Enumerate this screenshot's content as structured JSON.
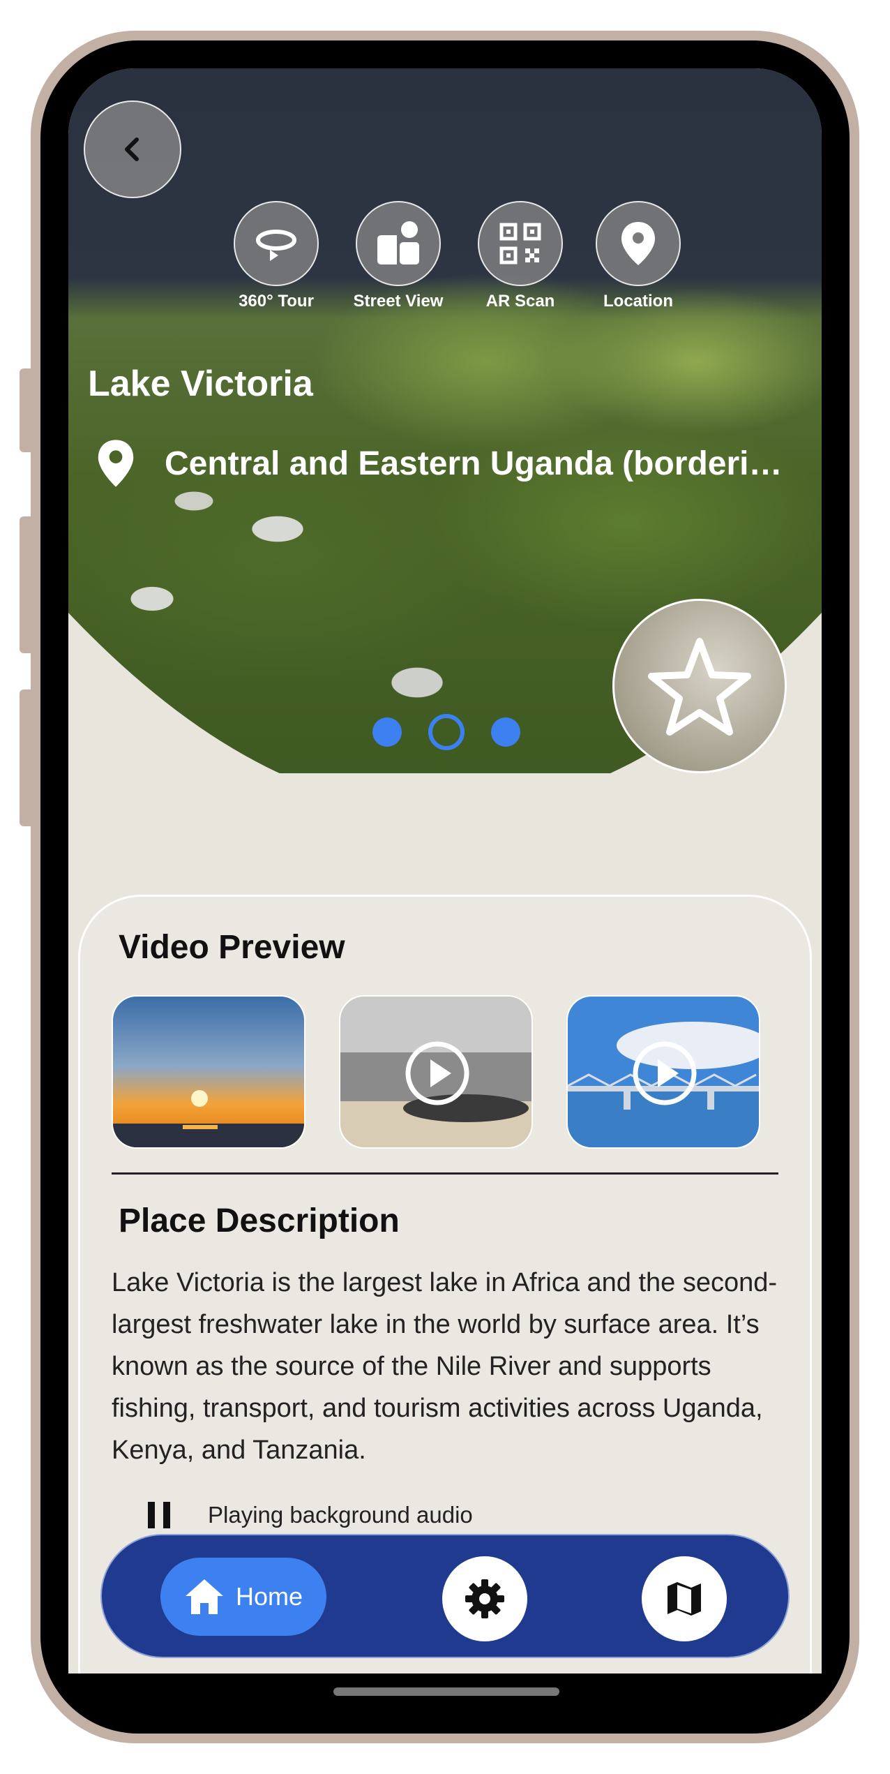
{
  "header": {
    "title": "Lake Victoria",
    "location": "Central and Eastern Uganda (bordering Kenya and Tanzania)"
  },
  "tools": [
    {
      "label": "360° Tour",
      "icon": "rotate-360-icon"
    },
    {
      "label": "Street View",
      "icon": "street-view-icon"
    },
    {
      "label": "AR Scan",
      "icon": "qr-scan-icon"
    },
    {
      "label": "Location",
      "icon": "location-pin-icon"
    }
  ],
  "carousel": {
    "count": 3,
    "active_index": 1
  },
  "video_preview": {
    "heading": "Video Preview",
    "videos": [
      {
        "name": "sunset-thumbnail"
      },
      {
        "name": "beach-thumbnail"
      },
      {
        "name": "bridge-thumbnail"
      }
    ]
  },
  "description": {
    "heading": "Place Description",
    "text": "Lake Victoria is the largest lake in Africa and the second-largest freshwater lake in the world by surface area. It’s known as the source of the Nile River and supports fishing, transport, and tourism activities across Uganda, Kenya, and Tanzania."
  },
  "audio": {
    "status": "Playing background audio"
  },
  "bottom_nav": {
    "home_label": "Home",
    "items": [
      "home",
      "settings",
      "map"
    ]
  },
  "colors": {
    "accent": "#3d80f0",
    "nav_bg": "#1f3a8f",
    "panel_bg": "#e8e5dd"
  }
}
